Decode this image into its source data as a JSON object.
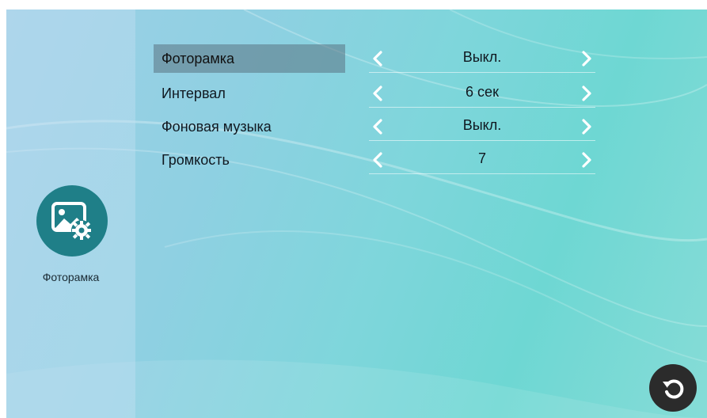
{
  "sidebar": {
    "app_icon": "photo-settings-icon",
    "app_label": "Фоторамка"
  },
  "settings": {
    "rows": [
      {
        "label": "Фоторамка",
        "value": "Выкл.",
        "selected": true
      },
      {
        "label": "Интервал",
        "value": "6 сек",
        "selected": false
      },
      {
        "label": "Фоновая музыка",
        "value": "Выкл.",
        "selected": false
      },
      {
        "label": "Громкость",
        "value": "7",
        "selected": false
      }
    ],
    "prev_icon": "chevron-left-icon",
    "next_icon": "chevron-right-icon"
  },
  "footer": {
    "back_icon": "undo-icon"
  },
  "colors": {
    "selection": "#5a7382",
    "icon_circle": "#1f7f88",
    "back_button": "#2b2b2b"
  }
}
